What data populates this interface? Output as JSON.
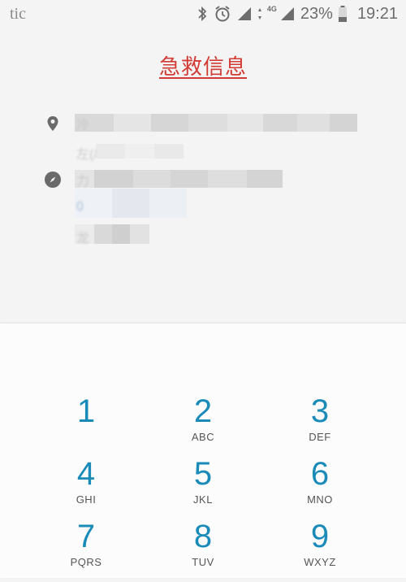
{
  "status_bar": {
    "carrier": "tic",
    "network": "4G",
    "battery": "23%",
    "time": "19:21"
  },
  "title": "急救信息",
  "info": {
    "row1_partial": [
      "冷",
      "左(/"
    ],
    "row2_partial": [
      "力",
      "0",
      "龙"
    ]
  },
  "dialpad": {
    "keys": [
      {
        "digit": "1",
        "letters": ""
      },
      {
        "digit": "2",
        "letters": "ABC"
      },
      {
        "digit": "3",
        "letters": "DEF"
      },
      {
        "digit": "4",
        "letters": "GHI"
      },
      {
        "digit": "5",
        "letters": "JKL"
      },
      {
        "digit": "6",
        "letters": "MNO"
      },
      {
        "digit": "7",
        "letters": "PQRS"
      },
      {
        "digit": "8",
        "letters": "TUV"
      },
      {
        "digit": "9",
        "letters": "WXYZ"
      }
    ]
  },
  "colors": {
    "title": "#d23b34",
    "digit": "#1a8bb8",
    "letters": "#555555"
  }
}
